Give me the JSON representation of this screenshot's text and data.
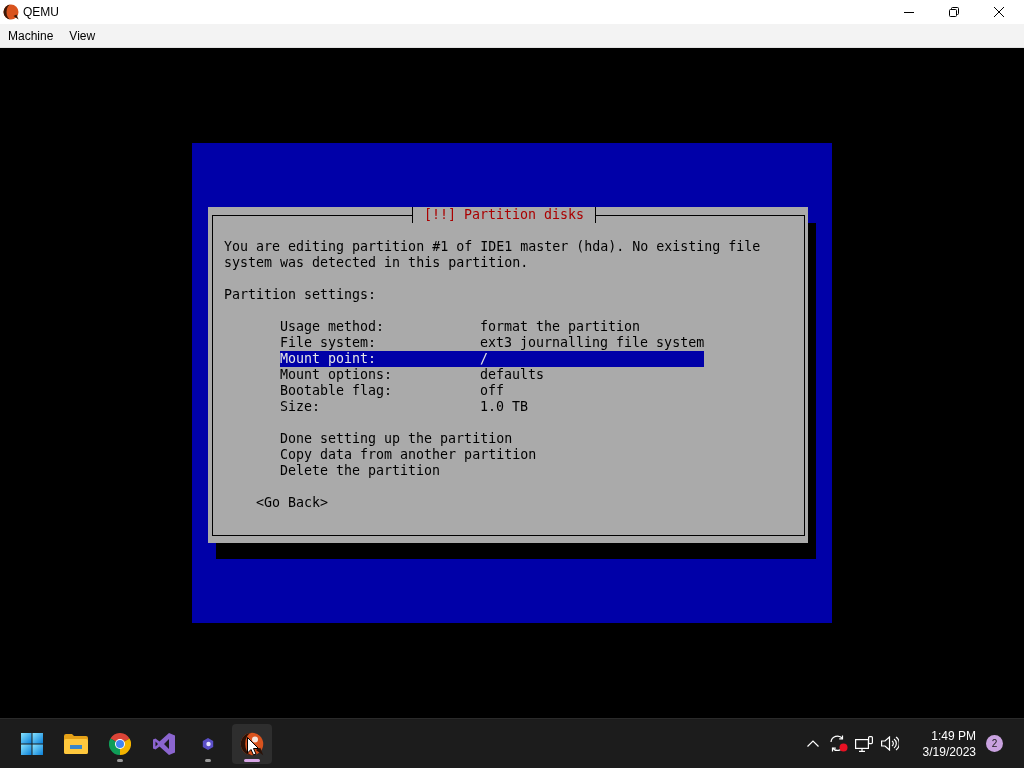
{
  "window": {
    "title": "QEMU",
    "menu": [
      {
        "label": "Machine"
      },
      {
        "label": "View"
      }
    ]
  },
  "dialog": {
    "title": "[!!] Partition disks",
    "message": "You are editing partition #1 of IDE1 master (hda). No existing file system was detected in this partition.",
    "settings_heading": "Partition settings:",
    "settings": [
      {
        "label": "Usage method:",
        "value": "format the partition",
        "selected": false
      },
      {
        "label": "File system:",
        "value": "ext3 journalling file system",
        "selected": false
      },
      {
        "label": "Mount point:",
        "value": "/",
        "selected": true
      },
      {
        "label": "Mount options:",
        "value": "defaults",
        "selected": false
      },
      {
        "label": "Bootable flag:",
        "value": "off",
        "selected": false
      },
      {
        "label": "Size:",
        "value": "1.0 TB",
        "selected": false
      }
    ],
    "actions": [
      {
        "label": "Done setting up the partition",
        "selected": false
      },
      {
        "label": "Copy data from another partition",
        "selected": false
      },
      {
        "label": "Delete the partition",
        "selected": false
      }
    ],
    "go_back": "<Go Back>"
  },
  "taskbar": {
    "apps": [
      {
        "kind": "start",
        "running": false,
        "selected": false
      },
      {
        "kind": "folder",
        "running": false,
        "selected": false
      },
      {
        "kind": "browser",
        "running": true,
        "selected": false
      },
      {
        "kind": "ide",
        "running": false,
        "selected": false
      },
      {
        "kind": "app",
        "running": true,
        "selected": false
      },
      {
        "kind": "emulator",
        "running": true,
        "selected": true
      }
    ],
    "tray": {
      "time": "1:49 PM",
      "date": "3/19/2023",
      "notification_count": "2"
    }
  }
}
